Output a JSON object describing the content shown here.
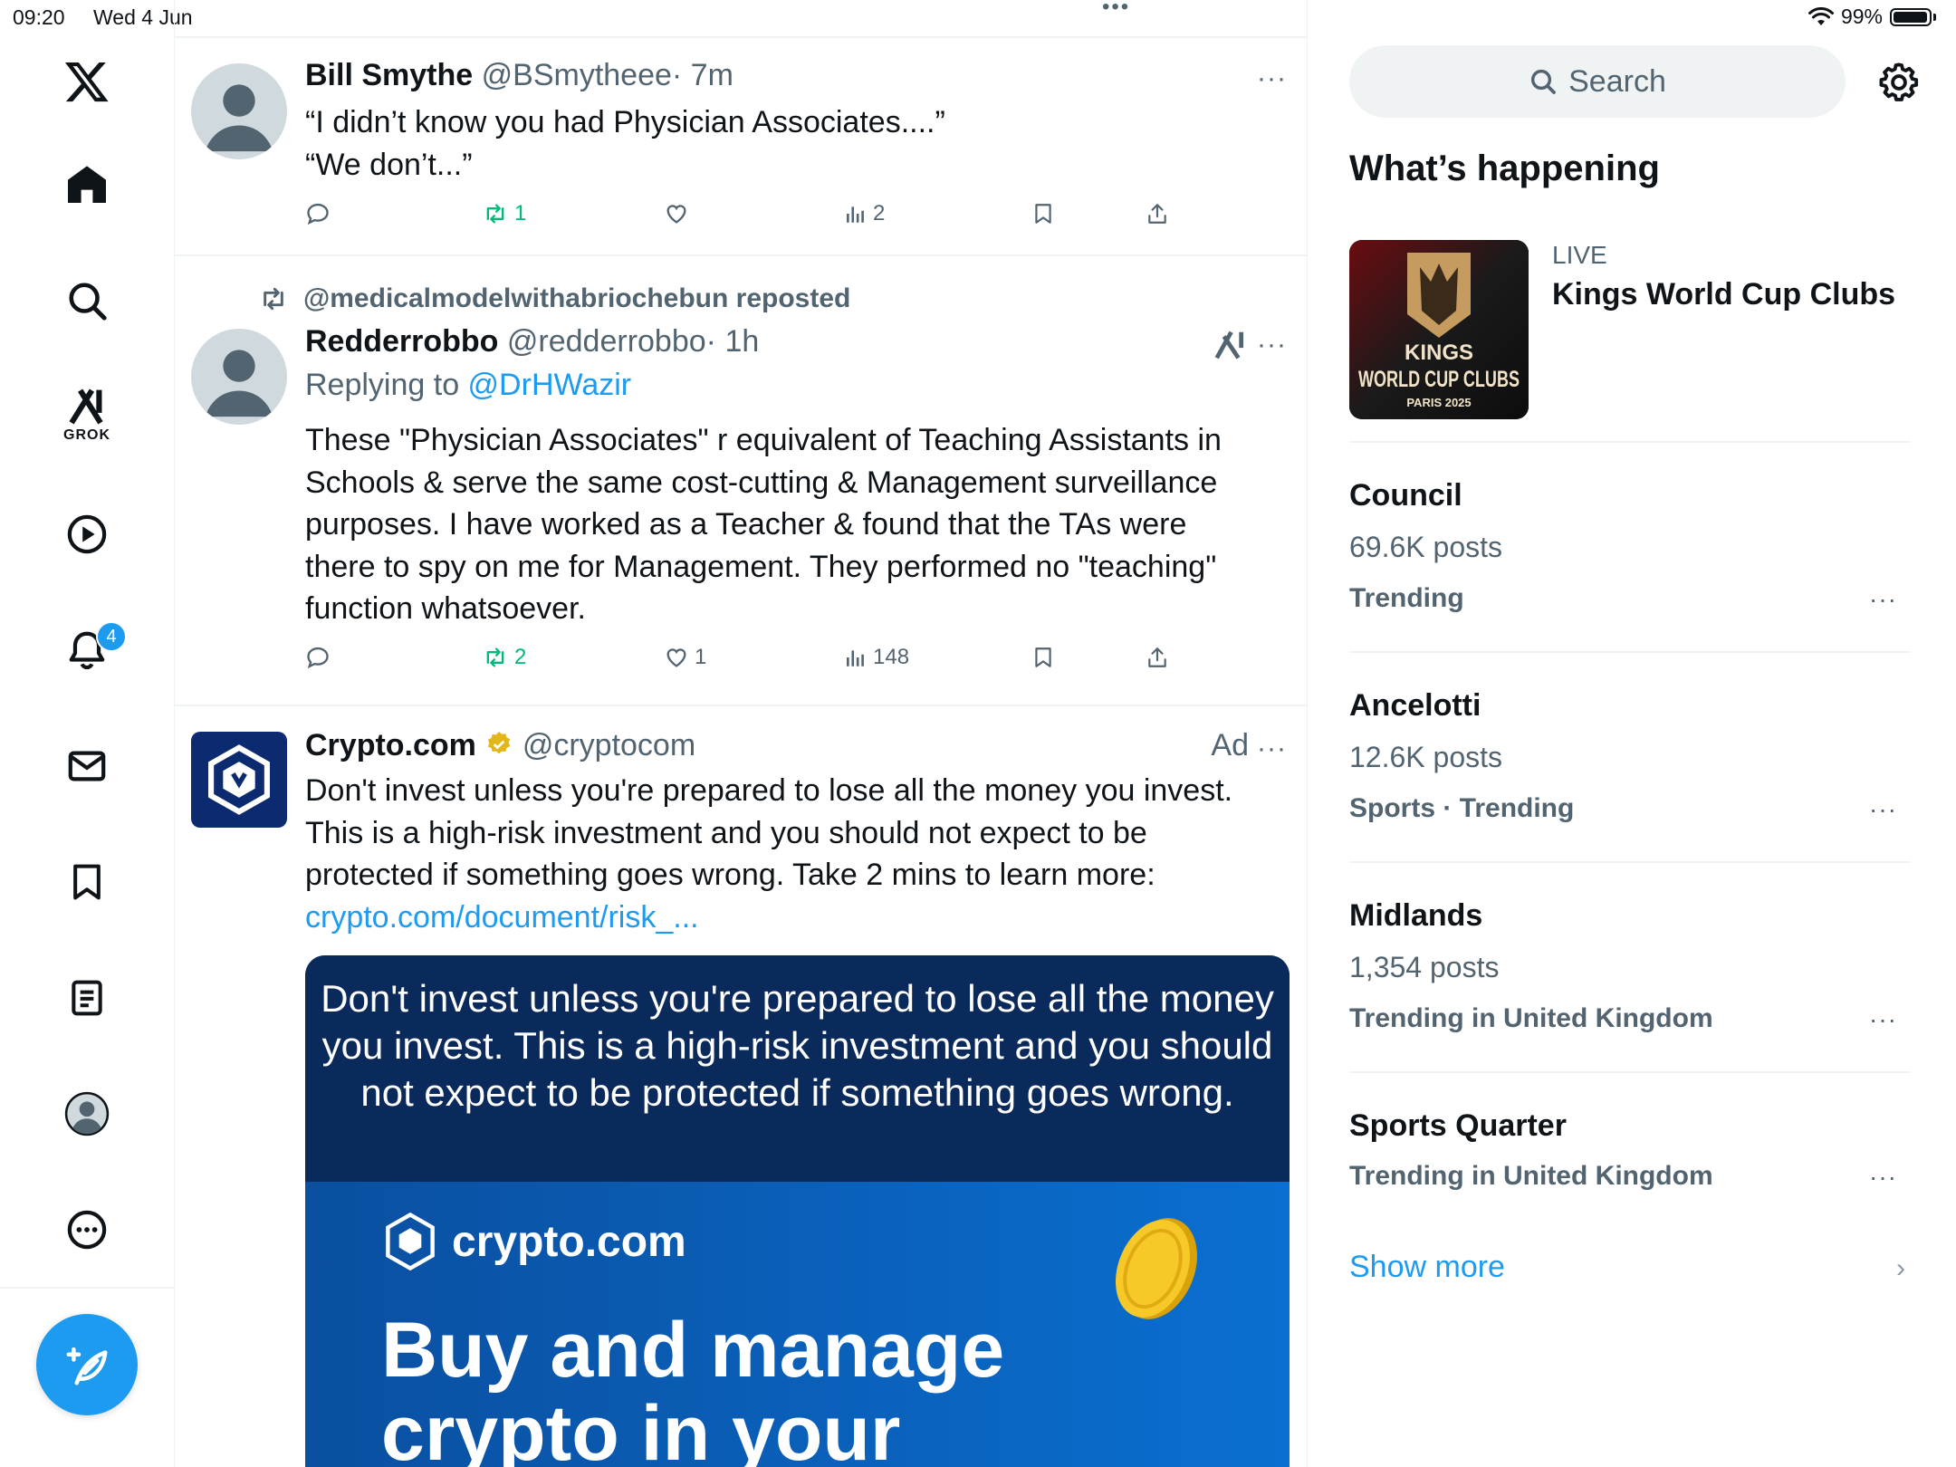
{
  "status": {
    "time": "09:20",
    "date": "Wed 4 Jun",
    "battery": "99%"
  },
  "nav": {
    "grok_label": "GROK",
    "notifications_badge": "4",
    "icons": [
      "x-logo-icon",
      "home-icon",
      "search-icon",
      "grok-icon",
      "video-icon",
      "bell-icon",
      "mail-icon",
      "bookmark-icon",
      "article-icon",
      "avatar-icon",
      "more-circle-icon",
      "compose-icon"
    ]
  },
  "timeline": {
    "top_dots": "•••",
    "tweets": [
      {
        "name": "Bill Smythe",
        "handle": "@BSmytheee",
        "time": "· 7m",
        "more": "···",
        "lines": [
          "“I didn’t know you had Physician Associates....”",
          "“We don’t...”"
        ],
        "retweets": "1",
        "likes": "",
        "views": "2"
      },
      {
        "repost_by": "@medicalmodelwithabriochebun reposted",
        "name": "Redderrobbo",
        "handle": "@redderrobbo",
        "time": "· 1h",
        "more": "···",
        "replying_prefix": "Replying to ",
        "replying_to": "@DrHWazir",
        "body": "These \"Physician Associates\" r equivalent of Teaching Assistants in Schools & serve the same cost-cutting & Management surveillance purposes. I have worked as a Teacher & found that the TAs were there to spy on me for Management. They performed no \"teaching\" function whatsoever.",
        "retweets": "2",
        "likes": "1",
        "views": "148"
      },
      {
        "name": "Crypto.com",
        "handle": "@cryptocom",
        "ad_label": "Ad",
        "more": "···",
        "body": "Don't invest unless you're prepared to lose all the money you invest. This is a high-risk investment and you should not expect to be protected if something goes wrong. Take 2 mins to learn more: ",
        "link": "crypto.com/document/risk_...",
        "media": {
          "warning": "Don't invest unless you're prepared to lose all the money you invest. This is a high-risk investment and you should not expect to be protected if something goes wrong.",
          "brand": "crypto.com",
          "headline": "Buy and manage crypto in your"
        }
      }
    ]
  },
  "sidebar": {
    "search_placeholder": "Search",
    "heading": "What’s happening",
    "live": {
      "label": "LIVE",
      "title": "Kings World Cup Clubs",
      "image_text": {
        "kings": "KINGS",
        "wcc": "WORLD CUP CLUBS",
        "paris": "PARIS 2025"
      }
    },
    "trends": [
      {
        "name": "Council",
        "posts": "69.6K posts",
        "category": "Trending"
      },
      {
        "name": "Ancelotti",
        "posts": "12.6K posts",
        "category": "Sports · Trending"
      },
      {
        "name": "Midlands",
        "posts": "1,354 posts",
        "category": "Trending in United Kingdom"
      },
      {
        "name": "Sports Quarter",
        "posts": "",
        "category": "Trending in United Kingdom"
      }
    ],
    "trend_more": "···",
    "show_more": "Show more",
    "chevron": "›"
  },
  "colors": {
    "accent": "#1d9bf0",
    "retweet_green": "#00ba7c",
    "secondary_text": "#536471",
    "ad_navy": "#0b2a5c"
  }
}
